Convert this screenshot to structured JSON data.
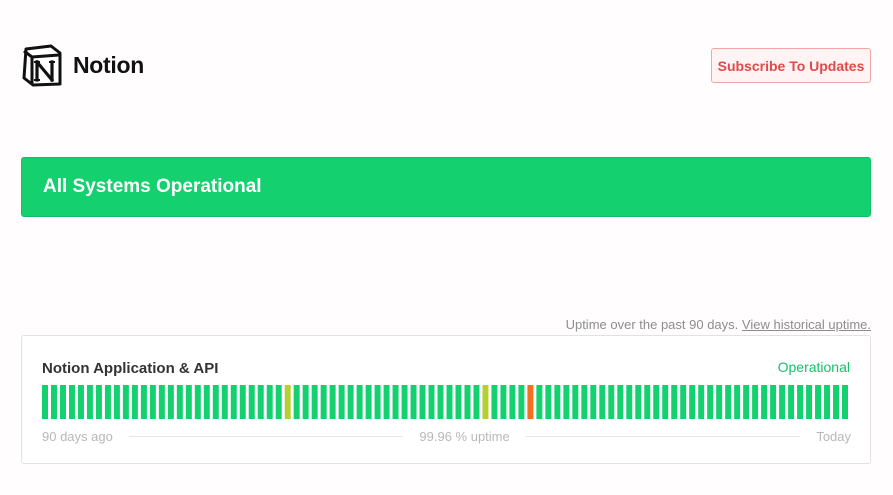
{
  "header": {
    "brand_name": "Notion",
    "logo_icon": "notion-logo-icon",
    "subscribe_label": "Subscribe To Updates"
  },
  "banner": {
    "text": "All Systems Operational",
    "color": "#15d06f"
  },
  "uptime": {
    "caption_prefix": "Uptime over the past 90 days.",
    "caption_link": "View historical uptime."
  },
  "component": {
    "name": "Notion Application & API",
    "status": "Operational",
    "legend_left": "90 days ago",
    "legend_center": "99.96 % uptime",
    "legend_right": "Today",
    "status_colors": {
      "operational": "#15d06f",
      "minor": "#b6cf33",
      "major": "#f1711c"
    },
    "days": [
      "operational",
      "operational",
      "operational",
      "operational",
      "operational",
      "operational",
      "operational",
      "operational",
      "operational",
      "operational",
      "operational",
      "operational",
      "operational",
      "operational",
      "operational",
      "operational",
      "operational",
      "operational",
      "operational",
      "operational",
      "operational",
      "operational",
      "operational",
      "operational",
      "operational",
      "operational",
      "operational",
      "minor",
      "operational",
      "operational",
      "operational",
      "operational",
      "operational",
      "operational",
      "operational",
      "operational",
      "operational",
      "operational",
      "operational",
      "operational",
      "operational",
      "operational",
      "operational",
      "operational",
      "operational",
      "operational",
      "operational",
      "operational",
      "operational",
      "minor",
      "operational",
      "operational",
      "operational",
      "operational",
      "major",
      "operational",
      "operational",
      "operational",
      "operational",
      "operational",
      "operational",
      "operational",
      "operational",
      "operational",
      "operational",
      "operational",
      "operational",
      "operational",
      "operational",
      "operational",
      "operational",
      "operational",
      "operational",
      "operational",
      "operational",
      "operational",
      "operational",
      "operational",
      "operational",
      "operational",
      "operational",
      "operational",
      "operational",
      "operational",
      "operational",
      "operational",
      "operational",
      "operational",
      "operational",
      "operational"
    ]
  }
}
